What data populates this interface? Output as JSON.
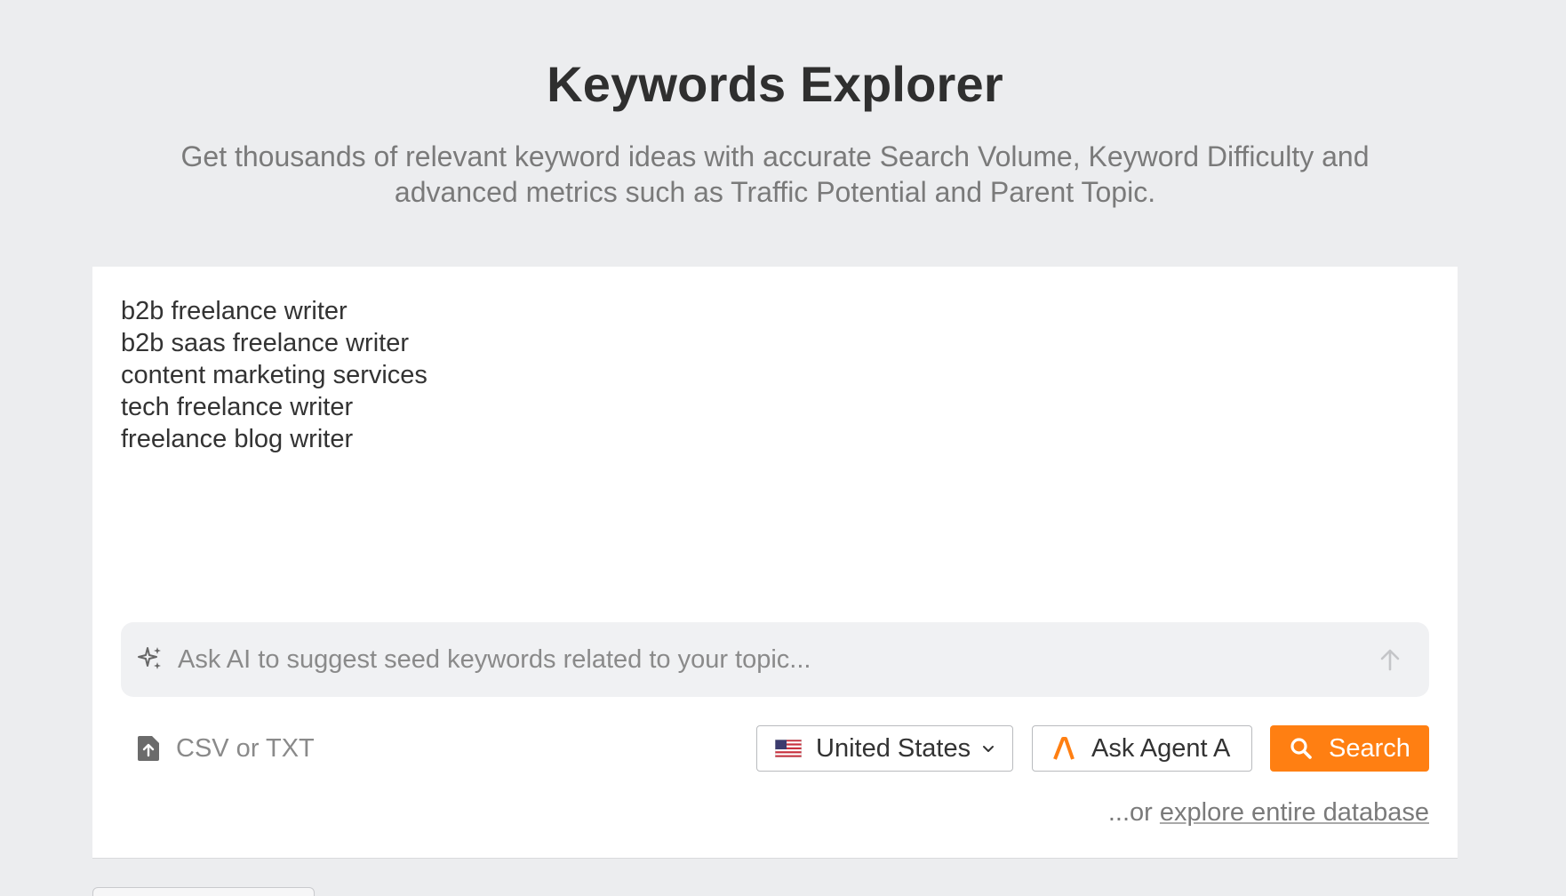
{
  "header": {
    "title": "Keywords Explorer",
    "subtitle_line1": "Get thousands of relevant keyword ideas with accurate Search Volume, Keyword Difficulty and",
    "subtitle_line2": "advanced metrics such as Traffic Potential and Parent Topic."
  },
  "keywords_box": {
    "value": "b2b freelance writer\nb2b saas freelance writer\ncontent marketing services\ntech freelance writer\nfreelance blog writer"
  },
  "ai_bar": {
    "icon": "sparkle-icon",
    "placeholder": "Ask AI to suggest seed keywords related to your topic...",
    "submit_icon": "arrow-up-icon"
  },
  "toolbar": {
    "upload_icon": "file-upload-icon",
    "upload_label": "CSV or TXT",
    "country_flag": "us-flag-icon",
    "country_label": "United States",
    "agent_icon": "agent-a-logo-icon",
    "agent_label": "Ask Agent A",
    "search_icon": "search-icon",
    "search_label": "Search"
  },
  "footer": {
    "prefix": "...or ",
    "link": "explore entire database"
  },
  "colors": {
    "background": "#ecedef",
    "accent": "#ff7f12",
    "panel": "#ffffff"
  }
}
